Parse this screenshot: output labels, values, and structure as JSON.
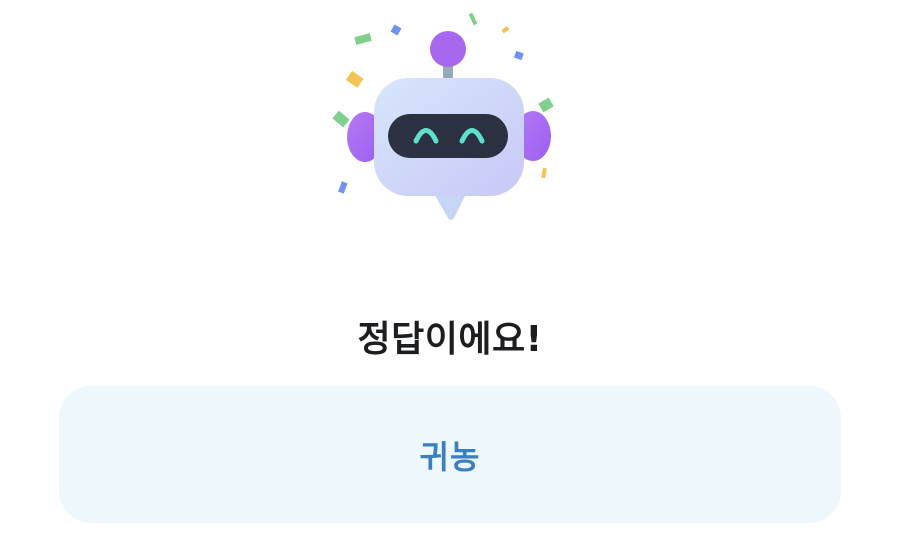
{
  "result": {
    "title": "정답이에요!"
  },
  "answer_button": {
    "label": "귀농"
  },
  "mascot": {
    "icon": "chat-robot-icon",
    "head_color": "#cfe0fb",
    "ear_color": "#a768f0",
    "antenna_color": "#a768f0",
    "visor_color": "#2b3140",
    "eye_color": "#5fe0cd"
  },
  "colors": {
    "title_text": "#1b1d20",
    "button_bg": "#eef7fc",
    "button_text": "#3a7fc0"
  }
}
